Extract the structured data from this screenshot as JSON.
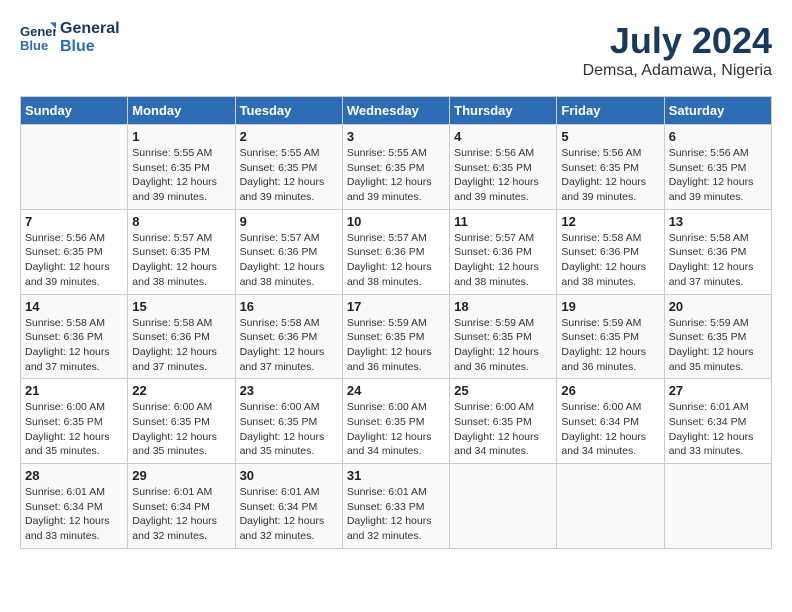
{
  "header": {
    "logo_line1": "General",
    "logo_line2": "Blue",
    "month_year": "July 2024",
    "location": "Demsa, Adamawa, Nigeria"
  },
  "days_of_week": [
    "Sunday",
    "Monday",
    "Tuesday",
    "Wednesday",
    "Thursday",
    "Friday",
    "Saturday"
  ],
  "weeks": [
    [
      {
        "day": "",
        "content": ""
      },
      {
        "day": "1",
        "content": "Sunrise: 5:55 AM\nSunset: 6:35 PM\nDaylight: 12 hours\nand 39 minutes."
      },
      {
        "day": "2",
        "content": "Sunrise: 5:55 AM\nSunset: 6:35 PM\nDaylight: 12 hours\nand 39 minutes."
      },
      {
        "day": "3",
        "content": "Sunrise: 5:55 AM\nSunset: 6:35 PM\nDaylight: 12 hours\nand 39 minutes."
      },
      {
        "day": "4",
        "content": "Sunrise: 5:56 AM\nSunset: 6:35 PM\nDaylight: 12 hours\nand 39 minutes."
      },
      {
        "day": "5",
        "content": "Sunrise: 5:56 AM\nSunset: 6:35 PM\nDaylight: 12 hours\nand 39 minutes."
      },
      {
        "day": "6",
        "content": "Sunrise: 5:56 AM\nSunset: 6:35 PM\nDaylight: 12 hours\nand 39 minutes."
      }
    ],
    [
      {
        "day": "7",
        "content": "Sunrise: 5:56 AM\nSunset: 6:35 PM\nDaylight: 12 hours\nand 39 minutes."
      },
      {
        "day": "8",
        "content": "Sunrise: 5:57 AM\nSunset: 6:35 PM\nDaylight: 12 hours\nand 38 minutes."
      },
      {
        "day": "9",
        "content": "Sunrise: 5:57 AM\nSunset: 6:36 PM\nDaylight: 12 hours\nand 38 minutes."
      },
      {
        "day": "10",
        "content": "Sunrise: 5:57 AM\nSunset: 6:36 PM\nDaylight: 12 hours\nand 38 minutes."
      },
      {
        "day": "11",
        "content": "Sunrise: 5:57 AM\nSunset: 6:36 PM\nDaylight: 12 hours\nand 38 minutes."
      },
      {
        "day": "12",
        "content": "Sunrise: 5:58 AM\nSunset: 6:36 PM\nDaylight: 12 hours\nand 38 minutes."
      },
      {
        "day": "13",
        "content": "Sunrise: 5:58 AM\nSunset: 6:36 PM\nDaylight: 12 hours\nand 37 minutes."
      }
    ],
    [
      {
        "day": "14",
        "content": "Sunrise: 5:58 AM\nSunset: 6:36 PM\nDaylight: 12 hours\nand 37 minutes."
      },
      {
        "day": "15",
        "content": "Sunrise: 5:58 AM\nSunset: 6:36 PM\nDaylight: 12 hours\nand 37 minutes."
      },
      {
        "day": "16",
        "content": "Sunrise: 5:58 AM\nSunset: 6:36 PM\nDaylight: 12 hours\nand 37 minutes."
      },
      {
        "day": "17",
        "content": "Sunrise: 5:59 AM\nSunset: 6:35 PM\nDaylight: 12 hours\nand 36 minutes."
      },
      {
        "day": "18",
        "content": "Sunrise: 5:59 AM\nSunset: 6:35 PM\nDaylight: 12 hours\nand 36 minutes."
      },
      {
        "day": "19",
        "content": "Sunrise: 5:59 AM\nSunset: 6:35 PM\nDaylight: 12 hours\nand 36 minutes."
      },
      {
        "day": "20",
        "content": "Sunrise: 5:59 AM\nSunset: 6:35 PM\nDaylight: 12 hours\nand 35 minutes."
      }
    ],
    [
      {
        "day": "21",
        "content": "Sunrise: 6:00 AM\nSunset: 6:35 PM\nDaylight: 12 hours\nand 35 minutes."
      },
      {
        "day": "22",
        "content": "Sunrise: 6:00 AM\nSunset: 6:35 PM\nDaylight: 12 hours\nand 35 minutes."
      },
      {
        "day": "23",
        "content": "Sunrise: 6:00 AM\nSunset: 6:35 PM\nDaylight: 12 hours\nand 35 minutes."
      },
      {
        "day": "24",
        "content": "Sunrise: 6:00 AM\nSunset: 6:35 PM\nDaylight: 12 hours\nand 34 minutes."
      },
      {
        "day": "25",
        "content": "Sunrise: 6:00 AM\nSunset: 6:35 PM\nDaylight: 12 hours\nand 34 minutes."
      },
      {
        "day": "26",
        "content": "Sunrise: 6:00 AM\nSunset: 6:34 PM\nDaylight: 12 hours\nand 34 minutes."
      },
      {
        "day": "27",
        "content": "Sunrise: 6:01 AM\nSunset: 6:34 PM\nDaylight: 12 hours\nand 33 minutes."
      }
    ],
    [
      {
        "day": "28",
        "content": "Sunrise: 6:01 AM\nSunset: 6:34 PM\nDaylight: 12 hours\nand 33 minutes."
      },
      {
        "day": "29",
        "content": "Sunrise: 6:01 AM\nSunset: 6:34 PM\nDaylight: 12 hours\nand 32 minutes."
      },
      {
        "day": "30",
        "content": "Sunrise: 6:01 AM\nSunset: 6:34 PM\nDaylight: 12 hours\nand 32 minutes."
      },
      {
        "day": "31",
        "content": "Sunrise: 6:01 AM\nSunset: 6:33 PM\nDaylight: 12 hours\nand 32 minutes."
      },
      {
        "day": "",
        "content": ""
      },
      {
        "day": "",
        "content": ""
      },
      {
        "day": "",
        "content": ""
      }
    ]
  ]
}
